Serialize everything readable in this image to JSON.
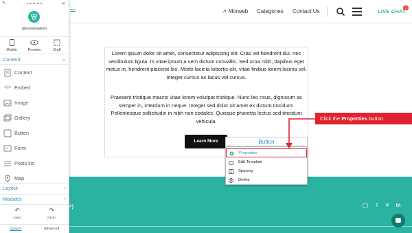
{
  "colors": {
    "accent": "#2a8fc9",
    "brand_teal": "#2ab3a0",
    "callout_red": "#e0232e",
    "dark_button": "#111111"
  },
  "panel": {
    "username": "@morwebadmin",
    "views": [
      {
        "label": "Mobile",
        "icon": "mobile-icon"
      },
      {
        "label": "Preview",
        "icon": "eye-icon"
      },
      {
        "label": "Draft",
        "icon": "draft-icon"
      }
    ],
    "sections": {
      "content": "Content",
      "layout": "Layout",
      "modules": "Modules"
    },
    "items": [
      {
        "label": "Content",
        "icon": "content-icon"
      },
      {
        "label": "Embed",
        "icon": "embed-icon"
      },
      {
        "label": "Image",
        "icon": "image-icon"
      },
      {
        "label": "Gallery",
        "icon": "gallery-icon"
      },
      {
        "label": "Button",
        "icon": "button-icon"
      },
      {
        "label": "Form",
        "icon": "form-icon"
      },
      {
        "label": "Posts list",
        "icon": "posts-list-icon"
      },
      {
        "label": "Map",
        "icon": "map-pin-icon"
      }
    ],
    "undo": "Undo",
    "redo": "Redo",
    "support": "Support",
    "advanced": "Advanced"
  },
  "site": {
    "nav": {
      "morweb": "Morweb",
      "categories": "Categories",
      "contact": "Contact Us",
      "live_chat": "LIVE CHAT",
      "live_badge": "1"
    },
    "para1": "Lorem ipsum dolor sit amet, consectetur adipiscing elit. Cras vel hendrerit dui, nec vestibulum ligula. In vitae ipsum a sem dictum convallis. Sed urna nibh, dapibus eget metus in, hendrerit placerat leo. Morbi lacinia lobortis elit, vitae finibus lorem lacinia vel. Integer cursus ac lacus vel cursus.",
    "para2": "Praesent tristique mauris vitae lorem volutpat tristique. Nunc leo risus, dignissim ac semper in, interdum in neque. Integer sed dolor sit amet ex dictum tincidunt. Pellentesque sollicitudin in nibh non sodales. Quisque pharetra lectus sed tincidunt vehicula.",
    "learn_more": "Learn More",
    "button_frame_label": "Button",
    "context_menu": {
      "properties": "Properties",
      "edit_template": "Edit Template",
      "spacing": "Spacing",
      "delete": "Delete"
    },
    "callout_prefix": "Click the ",
    "callout_bold": "Properties",
    "callout_suffix": " button",
    "social": [
      "instagram-icon",
      "facebook-icon",
      "x-icon",
      "linkedin-icon"
    ]
  }
}
